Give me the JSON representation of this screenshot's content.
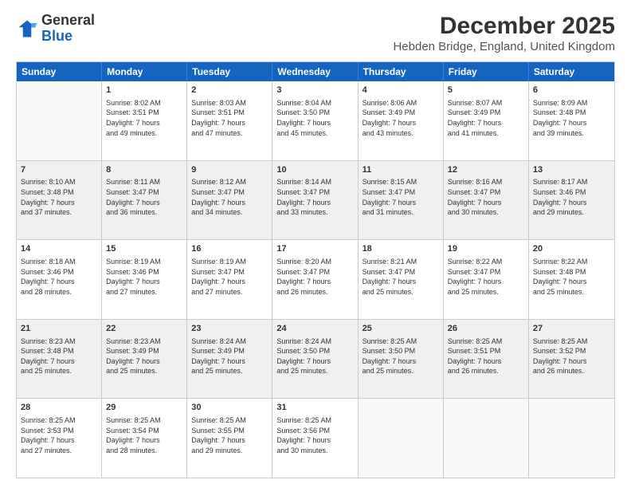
{
  "logo": {
    "general": "General",
    "blue": "Blue"
  },
  "title": "December 2025",
  "subtitle": "Hebden Bridge, England, United Kingdom",
  "days": [
    "Sunday",
    "Monday",
    "Tuesday",
    "Wednesday",
    "Thursday",
    "Friday",
    "Saturday"
  ],
  "rows": [
    [
      {
        "day": "",
        "info": "",
        "empty": true
      },
      {
        "day": "1",
        "info": "Sunrise: 8:02 AM\nSunset: 3:51 PM\nDaylight: 7 hours\nand 49 minutes.",
        "shaded": false
      },
      {
        "day": "2",
        "info": "Sunrise: 8:03 AM\nSunset: 3:51 PM\nDaylight: 7 hours\nand 47 minutes.",
        "shaded": false
      },
      {
        "day": "3",
        "info": "Sunrise: 8:04 AM\nSunset: 3:50 PM\nDaylight: 7 hours\nand 45 minutes.",
        "shaded": false
      },
      {
        "day": "4",
        "info": "Sunrise: 8:06 AM\nSunset: 3:49 PM\nDaylight: 7 hours\nand 43 minutes.",
        "shaded": false
      },
      {
        "day": "5",
        "info": "Sunrise: 8:07 AM\nSunset: 3:49 PM\nDaylight: 7 hours\nand 41 minutes.",
        "shaded": false
      },
      {
        "day": "6",
        "info": "Sunrise: 8:09 AM\nSunset: 3:48 PM\nDaylight: 7 hours\nand 39 minutes.",
        "shaded": false
      }
    ],
    [
      {
        "day": "7",
        "info": "Sunrise: 8:10 AM\nSunset: 3:48 PM\nDaylight: 7 hours\nand 37 minutes.",
        "shaded": true
      },
      {
        "day": "8",
        "info": "Sunrise: 8:11 AM\nSunset: 3:47 PM\nDaylight: 7 hours\nand 36 minutes.",
        "shaded": true
      },
      {
        "day": "9",
        "info": "Sunrise: 8:12 AM\nSunset: 3:47 PM\nDaylight: 7 hours\nand 34 minutes.",
        "shaded": true
      },
      {
        "day": "10",
        "info": "Sunrise: 8:14 AM\nSunset: 3:47 PM\nDaylight: 7 hours\nand 33 minutes.",
        "shaded": true
      },
      {
        "day": "11",
        "info": "Sunrise: 8:15 AM\nSunset: 3:47 PM\nDaylight: 7 hours\nand 31 minutes.",
        "shaded": true
      },
      {
        "day": "12",
        "info": "Sunrise: 8:16 AM\nSunset: 3:47 PM\nDaylight: 7 hours\nand 30 minutes.",
        "shaded": true
      },
      {
        "day": "13",
        "info": "Sunrise: 8:17 AM\nSunset: 3:46 PM\nDaylight: 7 hours\nand 29 minutes.",
        "shaded": true
      }
    ],
    [
      {
        "day": "14",
        "info": "Sunrise: 8:18 AM\nSunset: 3:46 PM\nDaylight: 7 hours\nand 28 minutes.",
        "shaded": false
      },
      {
        "day": "15",
        "info": "Sunrise: 8:19 AM\nSunset: 3:46 PM\nDaylight: 7 hours\nand 27 minutes.",
        "shaded": false
      },
      {
        "day": "16",
        "info": "Sunrise: 8:19 AM\nSunset: 3:47 PM\nDaylight: 7 hours\nand 27 minutes.",
        "shaded": false
      },
      {
        "day": "17",
        "info": "Sunrise: 8:20 AM\nSunset: 3:47 PM\nDaylight: 7 hours\nand 26 minutes.",
        "shaded": false
      },
      {
        "day": "18",
        "info": "Sunrise: 8:21 AM\nSunset: 3:47 PM\nDaylight: 7 hours\nand 25 minutes.",
        "shaded": false
      },
      {
        "day": "19",
        "info": "Sunrise: 8:22 AM\nSunset: 3:47 PM\nDaylight: 7 hours\nand 25 minutes.",
        "shaded": false
      },
      {
        "day": "20",
        "info": "Sunrise: 8:22 AM\nSunset: 3:48 PM\nDaylight: 7 hours\nand 25 minutes.",
        "shaded": false
      }
    ],
    [
      {
        "day": "21",
        "info": "Sunrise: 8:23 AM\nSunset: 3:48 PM\nDaylight: 7 hours\nand 25 minutes.",
        "shaded": true
      },
      {
        "day": "22",
        "info": "Sunrise: 8:23 AM\nSunset: 3:49 PM\nDaylight: 7 hours\nand 25 minutes.",
        "shaded": true
      },
      {
        "day": "23",
        "info": "Sunrise: 8:24 AM\nSunset: 3:49 PM\nDaylight: 7 hours\nand 25 minutes.",
        "shaded": true
      },
      {
        "day": "24",
        "info": "Sunrise: 8:24 AM\nSunset: 3:50 PM\nDaylight: 7 hours\nand 25 minutes.",
        "shaded": true
      },
      {
        "day": "25",
        "info": "Sunrise: 8:25 AM\nSunset: 3:50 PM\nDaylight: 7 hours\nand 25 minutes.",
        "shaded": true
      },
      {
        "day": "26",
        "info": "Sunrise: 8:25 AM\nSunset: 3:51 PM\nDaylight: 7 hours\nand 26 minutes.",
        "shaded": true
      },
      {
        "day": "27",
        "info": "Sunrise: 8:25 AM\nSunset: 3:52 PM\nDaylight: 7 hours\nand 26 minutes.",
        "shaded": true
      }
    ],
    [
      {
        "day": "28",
        "info": "Sunrise: 8:25 AM\nSunset: 3:53 PM\nDaylight: 7 hours\nand 27 minutes.",
        "shaded": false
      },
      {
        "day": "29",
        "info": "Sunrise: 8:25 AM\nSunset: 3:54 PM\nDaylight: 7 hours\nand 28 minutes.",
        "shaded": false
      },
      {
        "day": "30",
        "info": "Sunrise: 8:25 AM\nSunset: 3:55 PM\nDaylight: 7 hours\nand 29 minutes.",
        "shaded": false
      },
      {
        "day": "31",
        "info": "Sunrise: 8:25 AM\nSunset: 3:56 PM\nDaylight: 7 hours\nand 30 minutes.",
        "shaded": false
      },
      {
        "day": "",
        "info": "",
        "empty": true
      },
      {
        "day": "",
        "info": "",
        "empty": true
      },
      {
        "day": "",
        "info": "",
        "empty": true
      }
    ]
  ]
}
